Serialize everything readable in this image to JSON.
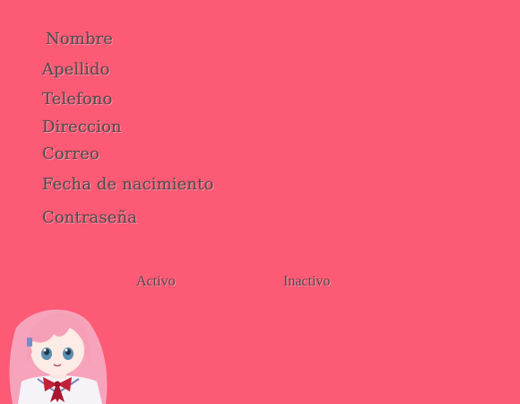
{
  "form": {
    "labels": {
      "nombre": "Nombre",
      "apellido": "Apellido",
      "telefono": "Telefono",
      "direccion": "Direccion",
      "correo": "Correo",
      "fecha_nacimiento": "Fecha de nacimiento",
      "contrasena": "Contraseña"
    },
    "status": {
      "active": "Activo",
      "inactive": "Inactivo"
    }
  },
  "colors": {
    "background": "#fd5a75",
    "label_text": "#4e4e4e",
    "hair": "#f7a3bb",
    "ribbon": "#c2203a"
  },
  "icons": {
    "mascot": "anime-girl-mascot-image"
  }
}
